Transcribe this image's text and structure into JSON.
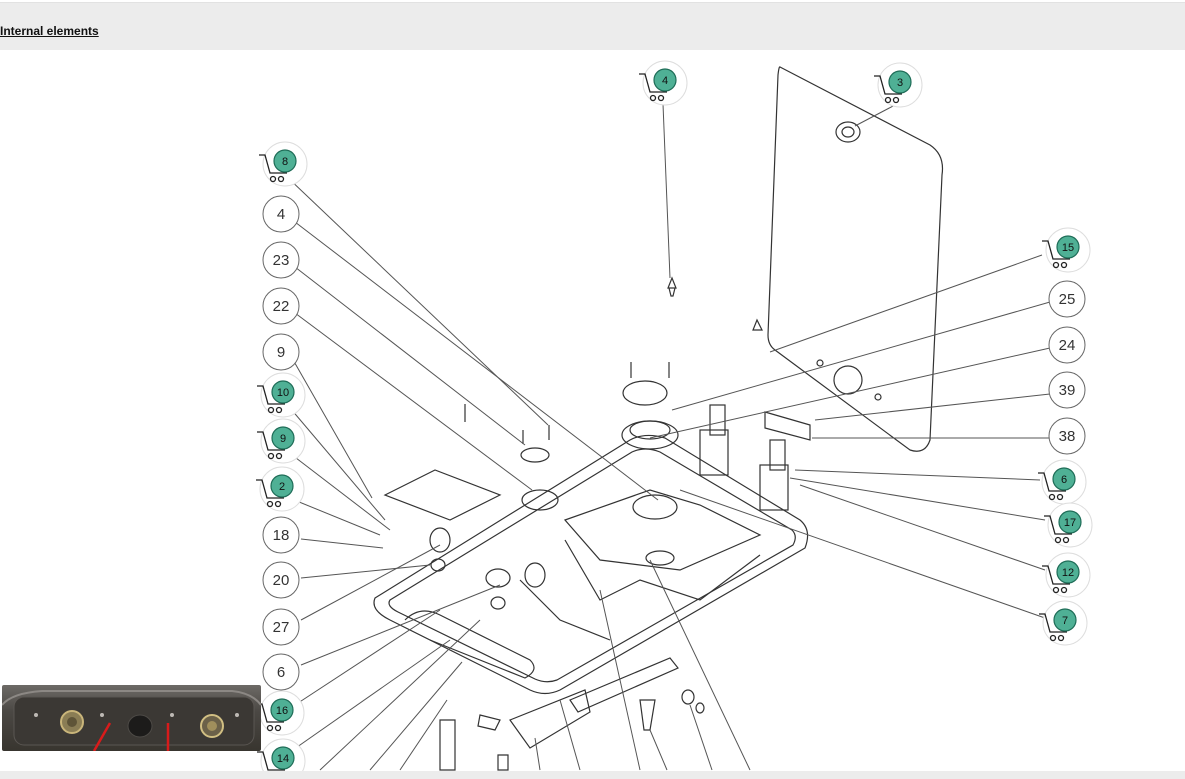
{
  "header": {
    "link_label": "Internal elements"
  },
  "cart_hotspots": [
    {
      "label": "4"
    },
    {
      "label": "3"
    },
    {
      "label": "8"
    },
    {
      "label": "15"
    },
    {
      "label": "10"
    },
    {
      "label": "9"
    },
    {
      "label": "2"
    },
    {
      "label": "6"
    },
    {
      "label": "17"
    },
    {
      "label": "12"
    },
    {
      "label": "7"
    },
    {
      "label": "16"
    },
    {
      "label": "14"
    }
  ],
  "callouts": [
    {
      "label": "4"
    },
    {
      "label": "23"
    },
    {
      "label": "22"
    },
    {
      "label": "9"
    },
    {
      "label": "18"
    },
    {
      "label": "20"
    },
    {
      "label": "27"
    },
    {
      "label": "6"
    },
    {
      "label": "25"
    },
    {
      "label": "24"
    },
    {
      "label": "39"
    },
    {
      "label": "38"
    }
  ],
  "colors": {
    "hotspot_fill": "#4fb095",
    "hotspot_border": "#1f6d58",
    "line": "#333333"
  },
  "icons": {
    "cart": "shopping-cart-icon"
  }
}
